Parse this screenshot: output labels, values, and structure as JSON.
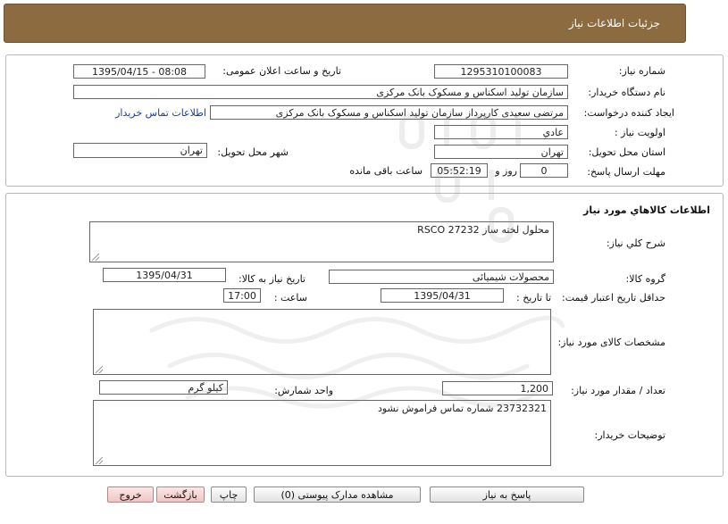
{
  "header": {
    "title": "جزئیات اطلاعات نیاز"
  },
  "info": {
    "need_number_label": "شماره نیاز:",
    "need_number": "1295310100083",
    "announce_label": "تاریخ و ساعت اعلان عمومی:",
    "announce_value": "1395/04/15 - 08:08",
    "buyer_label": "نام دستگاه خریدار:",
    "buyer_value": "سازمان تولید اسکناس و مسکوک بانک مرکزی",
    "creator_label": "ایجاد کننده درخواست:",
    "creator_value": "مرتضی سعیدی کارپرداز سازمان تولید اسکناس و مسکوک بانک مرکزی",
    "contact_link": "اطلاعات تماس خریدار",
    "priority_label": "اولویت نیاز :",
    "priority_value": "عادي",
    "province_label": "استان محل تحویل:",
    "province_value": "تهران",
    "city_label": "شهر محل تحویل:",
    "city_value": "تهران",
    "deadline_label": "مهلت ارسال پاسخ:",
    "days_value": "0",
    "days_label": "روز و",
    "time_value": "05:52:19",
    "remaining_label": "ساعت باقی مانده"
  },
  "goods": {
    "section_title": "اطلاعات کالاهاي مورد نياز",
    "desc_label": "شرح کلي نياز:",
    "desc_value": "محلول لخته ساز RSCO 27232",
    "group_label": "گروه کالا:",
    "group_value": "محصولات شیمیائی",
    "need_date_label": "تاریخ نیاز به کالا:",
    "need_date_value": "1395/04/31",
    "min_price_label": "حداقل تاریخ اعتبار قیمت:",
    "until_date_label": "تا تاریخ :",
    "until_date_value": "1395/04/31",
    "hour_label": "ساعت :",
    "hour_value": "17:00",
    "spec_label": "مشخصات کالای مورد نیاز:",
    "spec_value": "",
    "qty_label": "تعداد / مقدار مورد نیاز:",
    "qty_value": "1,200",
    "unit_label": "واحد شمارش:",
    "unit_value": "کیلو گرم",
    "buyer_notes_label": "توضیحات خریدار:",
    "buyer_notes_value": "23732321  شماره تماس فراموش نشود"
  },
  "buttons": {
    "reply": "پاسخ به نیاز",
    "attachments": "مشاهده مدارک پیوستی (0)",
    "print": "چاپ",
    "back": "بازگشت",
    "exit": "خروج"
  }
}
